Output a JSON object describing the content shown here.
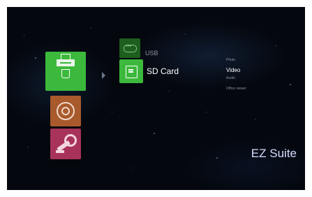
{
  "left_menu": {
    "items": [
      {
        "name": "media",
        "icon": "media-storage-icon",
        "color": "#3cb93c",
        "selected": true
      },
      {
        "name": "network",
        "icon": "network-icon",
        "color": "#a85a2c",
        "selected": false
      },
      {
        "name": "settings",
        "icon": "settings-icon",
        "color": "#a8335a",
        "selected": false
      }
    ]
  },
  "devices": [
    {
      "label": "USB",
      "icon": "usb-icon",
      "selected": false
    },
    {
      "label": "SD Card",
      "icon": "sd-card-icon",
      "selected": true
    }
  ],
  "media_types": {
    "photo": "Photo",
    "video": "Video",
    "audio": "Audio",
    "office": "Office viewer",
    "selected": "Video"
  },
  "brand": "EZ Suite",
  "colors": {
    "accent": "#3cb93c",
    "background": "#04070d",
    "brand_text": "#d6dcff"
  }
}
